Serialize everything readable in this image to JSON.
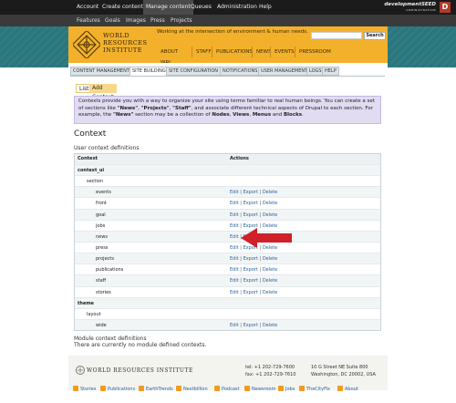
{
  "admin_bar": {
    "items": [
      "Account",
      "Create content",
      "Manage content",
      "Queues",
      "Administration",
      "Help"
    ],
    "active": "Manage content",
    "brand_line1": "developmentSEED",
    "brand_line2": "ADMINISTRATION",
    "brand_mark": "D"
  },
  "sub_bar": {
    "items": [
      "Features",
      "Goals",
      "Images",
      "Press",
      "Projects"
    ]
  },
  "header": {
    "org_name_line1": "WORLD",
    "org_name_line2": "RESOURCES",
    "org_name_line3": "INSTITUTE",
    "tagline": "Working at the intersection of environment & human needs.",
    "search_placeholder": "",
    "search_button": "Search",
    "nav": [
      "ABOUT WRI",
      "STAFF",
      "PUBLICATIONS",
      "NEWS",
      "EVENTS",
      "PRESSROOM"
    ]
  },
  "admin_tabs": [
    "CONTENT MANAGEMENT",
    "SITE BUILDING",
    "SITE CONFIGURATION",
    "NOTIFICATIONS",
    "USER MANAGEMENT",
    "LOGS",
    "HELP"
  ],
  "admin_tab_active": "SITE BUILDING",
  "sub_tabs": [
    "List",
    "Add Context"
  ],
  "description": {
    "part1": "Contexts provide you with a way to organize your site using terms familiar to real human beings. You can create a set of sections like ",
    "b1": "\"News\"",
    "part2": ", ",
    "b2": "\"Projects\"",
    "part3": ", ",
    "b3": "\"Staff\"",
    "part4": ", and associate different technical aspects of Drupal to each section. For example, the ",
    "b4": "\"News\"",
    "part5": " section may be a collection of ",
    "b5": "Nodes",
    "part6": ", ",
    "b6": "Views",
    "part7": ", ",
    "b7": "Menus",
    "part8": " and ",
    "b8": "Blocks",
    "part9": "."
  },
  "page_title": "Context",
  "table": {
    "caption": "User context definitions",
    "headers": [
      "Context",
      "Actions"
    ],
    "action_edit": "Edit",
    "action_export": "Export",
    "action_delete": "Delete",
    "action_sep": " | ",
    "rows": [
      {
        "label": "context_ui",
        "level": 1,
        "actions": false
      },
      {
        "label": "section",
        "level": 2,
        "actions": false
      },
      {
        "label": "events",
        "level": 3,
        "actions": true
      },
      {
        "label": "front",
        "level": 3,
        "actions": true
      },
      {
        "label": "goal",
        "level": 3,
        "actions": true
      },
      {
        "label": "jobs",
        "level": 3,
        "actions": true
      },
      {
        "label": "news",
        "level": 3,
        "actions": true
      },
      {
        "label": "press",
        "level": 3,
        "actions": true
      },
      {
        "label": "projects",
        "level": 3,
        "actions": true
      },
      {
        "label": "publications",
        "level": 3,
        "actions": true
      },
      {
        "label": "staff",
        "level": 3,
        "actions": true
      },
      {
        "label": "stories",
        "level": 3,
        "actions": true
      },
      {
        "label": "theme",
        "level": 1,
        "actions": false
      },
      {
        "label": "layout",
        "level": 2,
        "actions": false
      },
      {
        "label": "wide",
        "level": 3,
        "actions": true
      }
    ]
  },
  "module_contexts": {
    "title": "Module context definitions",
    "empty": "There are currently no module defined contexts."
  },
  "footer": {
    "name": "WORLD RESOURCES INSTITUTE",
    "tel": "tel: +1 202-729-7600",
    "fax": "fax: +1 202-729-7610",
    "addr1": "10 G Street NE Suite 800",
    "addr2": "Washington, DC 20002, USA",
    "feeds": [
      "Stories",
      "Publications",
      "EarthTrends",
      "Nextbillion",
      "Podcast",
      "Newsroom",
      "Jobs",
      "TheCityFix",
      "About"
    ]
  },
  "colors": {
    "accent": "#f3b12b",
    "teal": "#2e7d84",
    "admin_bar": "#1b1b1b",
    "arrow": "#d0202a",
    "link": "#2a63a0"
  }
}
